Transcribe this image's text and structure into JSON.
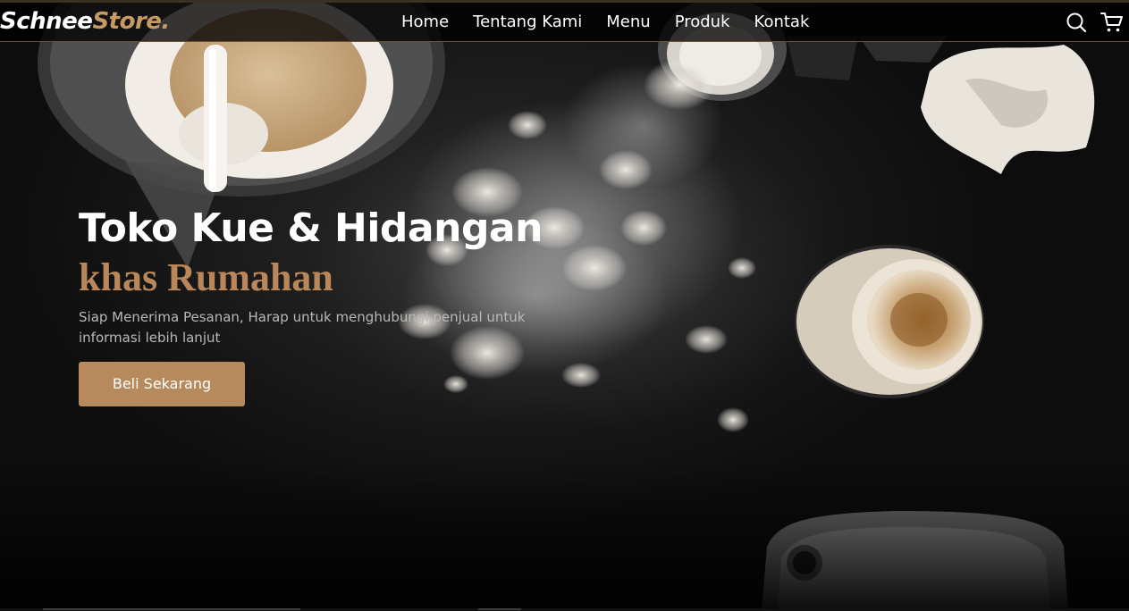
{
  "brand": {
    "part1": "Schnee",
    "part2": "Store."
  },
  "nav": {
    "items": [
      {
        "label": "Home"
      },
      {
        "label": "Tentang Kami"
      },
      {
        "label": "Menu"
      },
      {
        "label": "Produk"
      },
      {
        "label": "Kontak"
      }
    ],
    "icons": [
      "search-icon",
      "cart-icon"
    ]
  },
  "hero": {
    "title_line1": "Toko Kue & Hidangan",
    "title_line2": "khas Rumahan",
    "subtitle": "Siap Menerima Pesanan, Harap untuk menghubungi penjual untuk informasi lebih lanjut",
    "cta_label": "Beli Sekarang"
  },
  "colors": {
    "accent": "#b68a5d",
    "title_accent": "#b9875a",
    "brand_accent": "#c89a63",
    "background": "#0b0b0b"
  }
}
